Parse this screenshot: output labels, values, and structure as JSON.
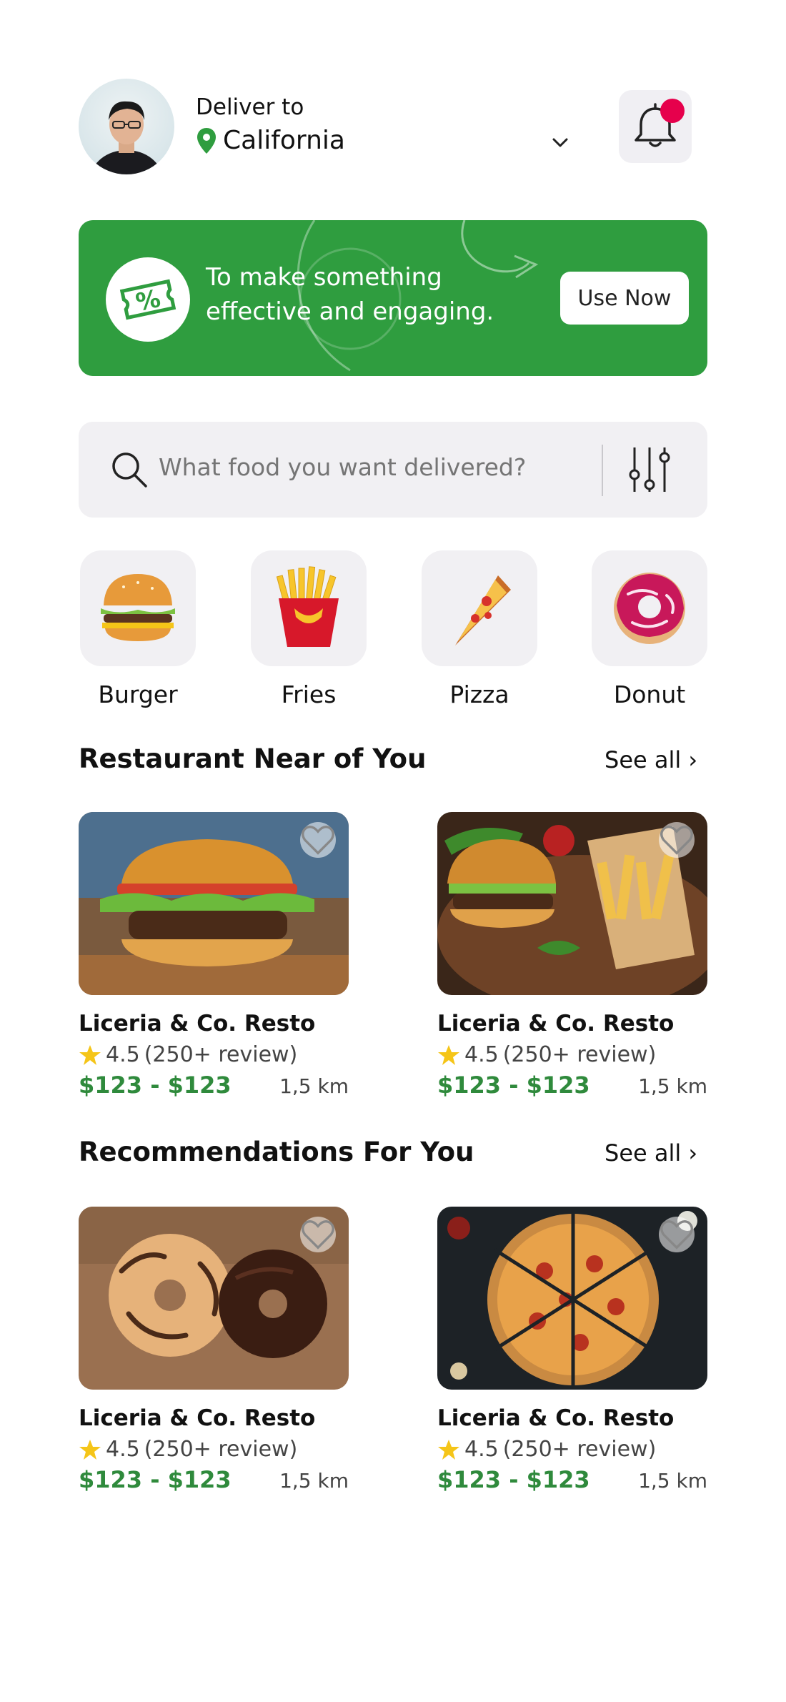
{
  "header": {
    "deliver_label": "Deliver to",
    "location": "California"
  },
  "banner": {
    "text": "To make something effective and engaging.",
    "button_label": "Use Now",
    "color": "#2f9d3f"
  },
  "search": {
    "placeholder": "What food you want delivered?"
  },
  "categories": [
    {
      "label": "Burger"
    },
    {
      "label": "Fries"
    },
    {
      "label": "Pizza"
    },
    {
      "label": "Donut"
    }
  ],
  "sections": {
    "near": {
      "title": "Restaurant Near of You",
      "see_all": "See all ›",
      "cards": [
        {
          "name": "Liceria & Co. Resto",
          "rating": "4.5",
          "reviews": "(250+ review)",
          "price": "$123 - $123",
          "distance": "1,5 km"
        },
        {
          "name": "Liceria & Co. Resto",
          "rating": "4.5",
          "reviews": "(250+ review)",
          "price": "$123 - $123",
          "distance": "1,5 km"
        }
      ]
    },
    "recommended": {
      "title": "Recommendations For You",
      "see_all": "See all ›",
      "cards": [
        {
          "name": "Liceria & Co. Resto",
          "rating": "4.5",
          "reviews": "(250+ review)",
          "price": "$123 - $123",
          "distance": "1,5 km"
        },
        {
          "name": "Liceria & Co. Resto",
          "rating": "4.5",
          "reviews": "(250+ review)",
          "price": "$123 - $123",
          "distance": "1,5 km"
        }
      ]
    }
  },
  "colors": {
    "accent_green": "#2f9d3f",
    "price_green": "#2f8a3c",
    "notification_red": "#e6004c",
    "star_yellow": "#f5c518"
  }
}
